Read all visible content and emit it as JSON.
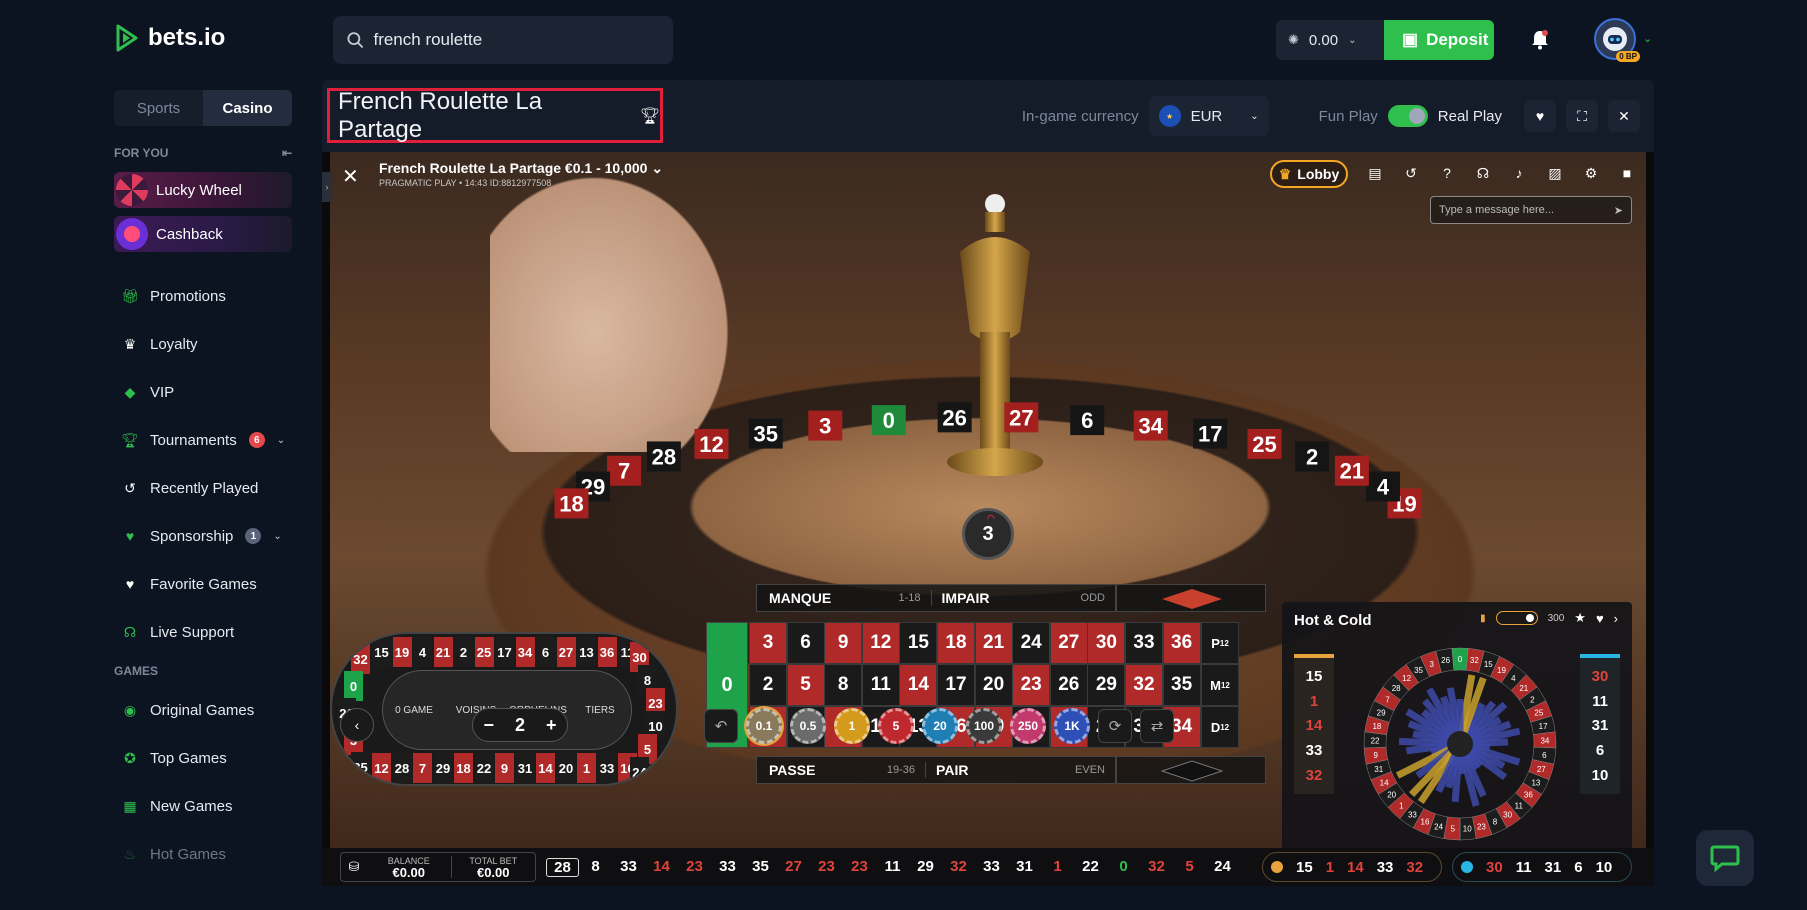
{
  "brand": {
    "name": "bets.io"
  },
  "search": {
    "value": "french roulette",
    "icon": "search-icon"
  },
  "wallet": {
    "balance": "0.00",
    "deposit_label": "Deposit"
  },
  "avatar": {
    "badge": "0 BP"
  },
  "sidebar": {
    "tabs": [
      "Sports",
      "Casino"
    ],
    "active_tab": "Casino",
    "for_you_label": "FOR YOU",
    "promos": [
      {
        "label": "Lucky Wheel"
      },
      {
        "label": "Cashback"
      }
    ],
    "items": [
      {
        "label": "Promotions",
        "icon": "gift-icon"
      },
      {
        "label": "Loyalty",
        "icon": "crown-icon"
      },
      {
        "label": "VIP",
        "icon": "diamond-icon"
      },
      {
        "label": "Tournaments",
        "icon": "trophy-icon",
        "badge": "6"
      },
      {
        "label": "Recently Played",
        "icon": "history-icon"
      },
      {
        "label": "Sponsorship",
        "icon": "handshake-icon",
        "badge": "1"
      },
      {
        "label": "Favorite Games",
        "icon": "heart-icon"
      },
      {
        "label": "Live Support",
        "icon": "headset-icon"
      }
    ],
    "games_label": "GAMES",
    "games": [
      {
        "label": "Original Games",
        "icon": "original-icon"
      },
      {
        "label": "Top Games",
        "icon": "medal-icon"
      },
      {
        "label": "New Games",
        "icon": "grid-icon"
      },
      {
        "label": "Hot Games",
        "icon": "flame-icon"
      }
    ]
  },
  "game_header": {
    "title": "French Roulette La Partage",
    "currency_label": "In-game currency",
    "currency": "EUR",
    "fun_play": "Fun Play",
    "real_play": "Real Play"
  },
  "game": {
    "table_name": "French Roulette La Partage €0.1 - 10,000",
    "table_sub": "PRAGMATIC PLAY • 14:43 ID:8812977508",
    "lobby_label": "Lobby",
    "chat_placeholder": "Type a message here...",
    "last_result": "3",
    "wheel_numbers_visible": [
      "19",
      "4",
      "21",
      "2",
      "25",
      "17",
      "34",
      "6",
      "27",
      "26",
      "0",
      "3",
      "35",
      "12",
      "28",
      "7",
      "29",
      "18"
    ],
    "racetrack": {
      "top": [
        "15",
        "19",
        "4",
        "21",
        "2",
        "25",
        "17",
        "34",
        "6",
        "27",
        "13",
        "36",
        "11"
      ],
      "bottom": [
        "12",
        "28",
        "7",
        "29",
        "18",
        "22",
        "9",
        "31",
        "14",
        "20",
        "1",
        "33",
        "16"
      ],
      "left": [
        "32",
        "0",
        "26",
        "3",
        "35"
      ],
      "right": [
        "30",
        "8",
        "23",
        "10",
        "5",
        "24"
      ],
      "sections": [
        "0 GAME",
        "VOISINS",
        "ORPHELINS",
        "TIERS"
      ]
    },
    "bet_table": {
      "zero": "0",
      "top_labels": [
        {
          "main": "MANQUE",
          "sub": "1-18"
        },
        {
          "main": "IMPAIR",
          "sub": "ODD"
        }
      ],
      "bottom_labels": [
        {
          "main": "PASSE",
          "sub": "19-36"
        },
        {
          "main": "PAIR",
          "sub": "EVEN"
        }
      ],
      "rows": [
        [
          "3",
          "6",
          "9",
          "12",
          "15",
          "18",
          "21",
          "24",
          "27",
          "30",
          "33",
          "36"
        ],
        [
          "2",
          "5",
          "8",
          "11",
          "14",
          "17",
          "20",
          "23",
          "26",
          "29",
          "32",
          "35"
        ],
        [
          "1",
          "4",
          "7",
          "10",
          "13",
          "16",
          "19",
          "22",
          "25",
          "28",
          "31",
          "34"
        ]
      ],
      "red_numbers": [
        "1",
        "3",
        "5",
        "7",
        "9",
        "12",
        "14",
        "16",
        "18",
        "19",
        "21",
        "23",
        "25",
        "27",
        "30",
        "32",
        "34",
        "36"
      ],
      "column_bets": [
        "P12",
        "M12",
        "D12"
      ]
    },
    "stepper_value": "2",
    "chips": [
      {
        "label": "0.1",
        "color": "#8a7a5c"
      },
      {
        "label": "0.5",
        "color": "#6b6b6b"
      },
      {
        "label": "1",
        "color": "#d49a1c"
      },
      {
        "label": "5",
        "color": "#c0282f"
      },
      {
        "label": "20",
        "color": "#1f7fb5"
      },
      {
        "label": "100",
        "color": "#3a3a3a"
      },
      {
        "label": "250",
        "color": "#c2396b"
      },
      {
        "label": "1K",
        "color": "#2f4fb8"
      }
    ],
    "hot_cold": {
      "title": "Hot & Cold",
      "spins": "300",
      "hot": [
        "15",
        "1",
        "14",
        "33",
        "32"
      ],
      "cold": [
        "30",
        "11",
        "31",
        "6",
        "10"
      ],
      "wheel": [
        "0",
        "32",
        "15",
        "19",
        "4",
        "21",
        "2",
        "25",
        "17",
        "34",
        "6",
        "27",
        "13",
        "36",
        "11",
        "30",
        "8",
        "23",
        "10",
        "5",
        "24",
        "16",
        "33",
        "1",
        "20",
        "14",
        "31",
        "9",
        "22",
        "18",
        "29",
        "7",
        "28",
        "12",
        "35",
        "3",
        "26"
      ]
    },
    "balance_label": "BALANCE",
    "balance_value": "€0.00",
    "total_bet_label": "TOTAL BET",
    "total_bet_value": "€0.00",
    "history": [
      "28",
      "8",
      "33",
      "14",
      "23",
      "33",
      "35",
      "27",
      "23",
      "23",
      "11",
      "29",
      "32",
      "33",
      "31",
      "1",
      "22",
      "0",
      "32",
      "5",
      "24"
    ]
  }
}
